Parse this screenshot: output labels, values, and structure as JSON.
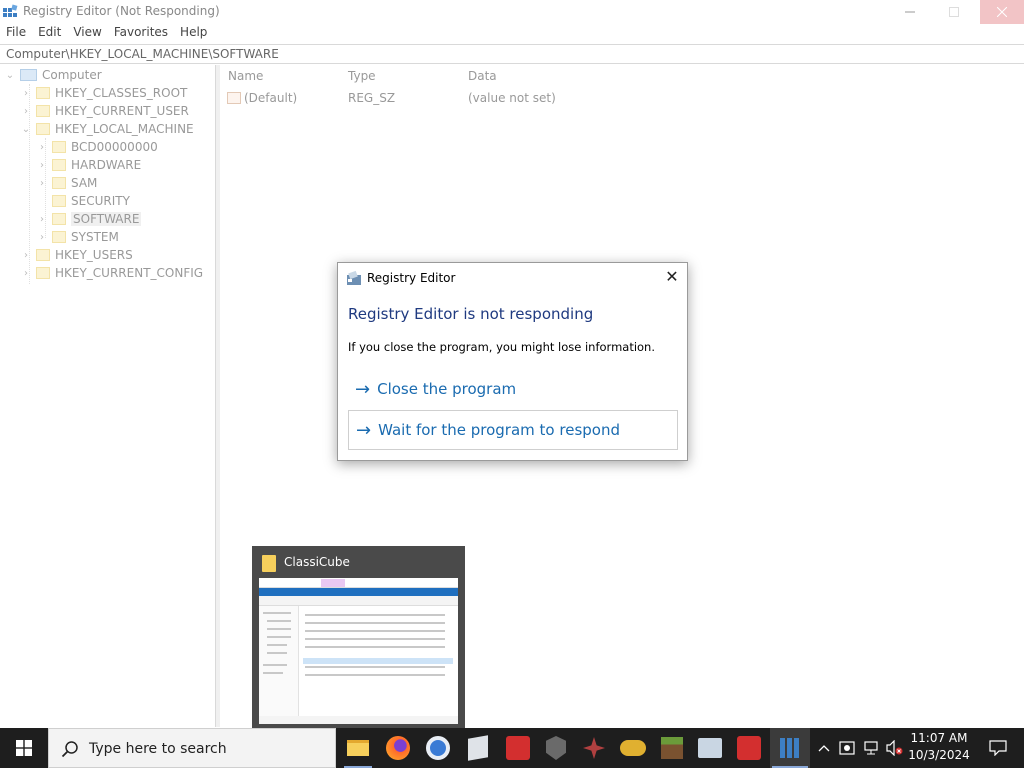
{
  "window": {
    "title": "Registry Editor (Not Responding)",
    "menu": [
      "File",
      "Edit",
      "View",
      "Favorites",
      "Help"
    ],
    "address": "Computer\\HKEY_LOCAL_MACHINE\\SOFTWARE"
  },
  "tree": {
    "root": "Computer",
    "hives": [
      "HKEY_CLASSES_ROOT",
      "HKEY_CURRENT_USER",
      "HKEY_LOCAL_MACHINE"
    ],
    "hklm_children": [
      "BCD00000000",
      "HARDWARE",
      "SAM",
      "SECURITY",
      "SOFTWARE",
      "SYSTEM"
    ],
    "hives_after": [
      "HKEY_USERS",
      "HKEY_CURRENT_CONFIG"
    ],
    "selected": "SOFTWARE"
  },
  "list": {
    "columns": [
      "Name",
      "Type",
      "Data"
    ],
    "rows": [
      {
        "name": "(Default)",
        "type": "REG_SZ",
        "data": "(value not set)"
      }
    ]
  },
  "dialog": {
    "title": "Registry Editor",
    "heading": "Registry Editor is not responding",
    "body": "If you close the program, you might lose information.",
    "option_close": "Close the program",
    "option_wait": "Wait for the program to respond",
    "arrow_glyph": "→",
    "close_glyph": "✕"
  },
  "thumbnail": {
    "title": "ClassiCube"
  },
  "taskbar": {
    "search_placeholder": "Type here to search",
    "apps": [
      {
        "name": "file-explorer",
        "color": "#f6cf5c"
      },
      {
        "name": "firefox",
        "color": "#e25a2a"
      },
      {
        "name": "chrome",
        "color": "#3a7bd5"
      },
      {
        "name": "virtualbox",
        "color": "#d9d9d9"
      },
      {
        "name": "kaspersky",
        "color": "#d32f2f"
      },
      {
        "name": "world-of-tanks",
        "color": "#5a5a5a"
      },
      {
        "name": "ranger-game",
        "color": "#b04040"
      },
      {
        "name": "game-controller",
        "color": "#e0b030"
      },
      {
        "name": "minecraft",
        "color": "#6b8f3a"
      },
      {
        "name": "control-panel",
        "color": "#c9d6e3"
      },
      {
        "name": "kaspersky-2",
        "color": "#d32f2f"
      },
      {
        "name": "registry-editor",
        "color": "#3d7fc4"
      }
    ],
    "time": "11:07 AM",
    "date": "10/3/2024"
  },
  "colors": {
    "accent": "#1a6bb0",
    "heading": "#1f3a80",
    "taskbar": "#1e1e1e"
  }
}
